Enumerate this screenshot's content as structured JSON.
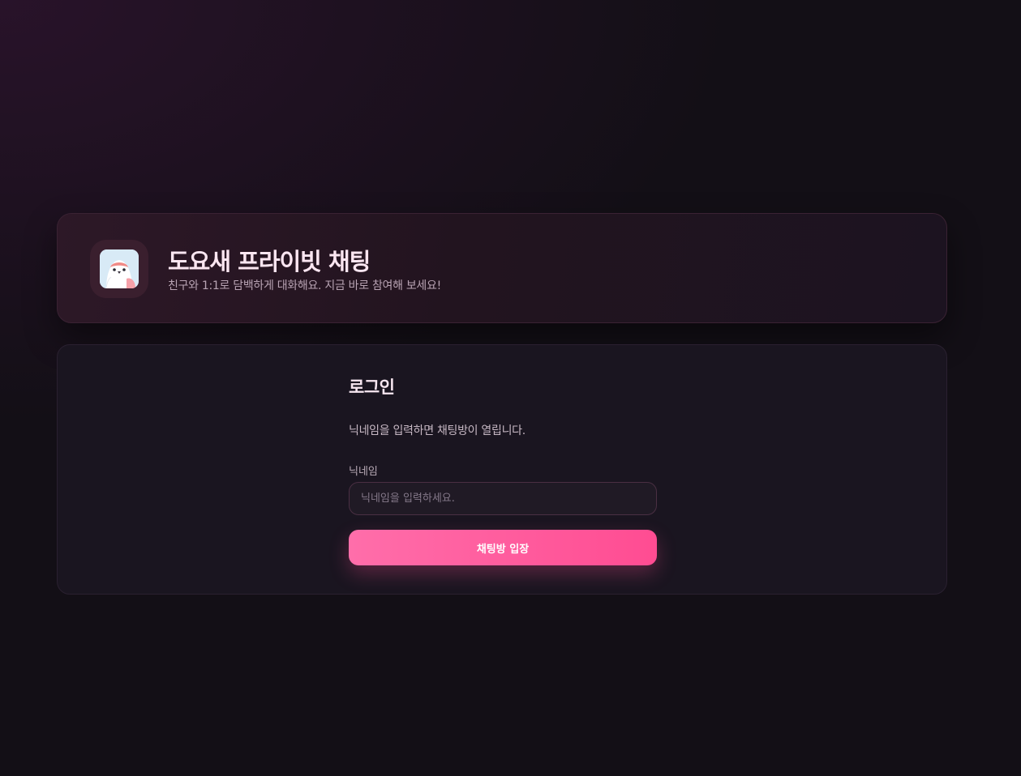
{
  "header": {
    "logo_icon": "bird-logo-icon",
    "title": "도요새 프라이빗 채팅",
    "subtitle": "친구와 1:1로 담백하게 대화해요. 지금 바로 참여해 보세요!"
  },
  "login": {
    "title": "로그인",
    "description": "닉네임을 입력하면 채팅방이 열립니다.",
    "nickname_label": "닉네임",
    "nickname_placeholder": "닉네임을 입력하세요.",
    "nickname_value": "",
    "submit_label": "채팅방 입장"
  },
  "colors": {
    "background": "#130f16",
    "accent": "#ff5c9d",
    "title_text": "#fbe6f1"
  }
}
